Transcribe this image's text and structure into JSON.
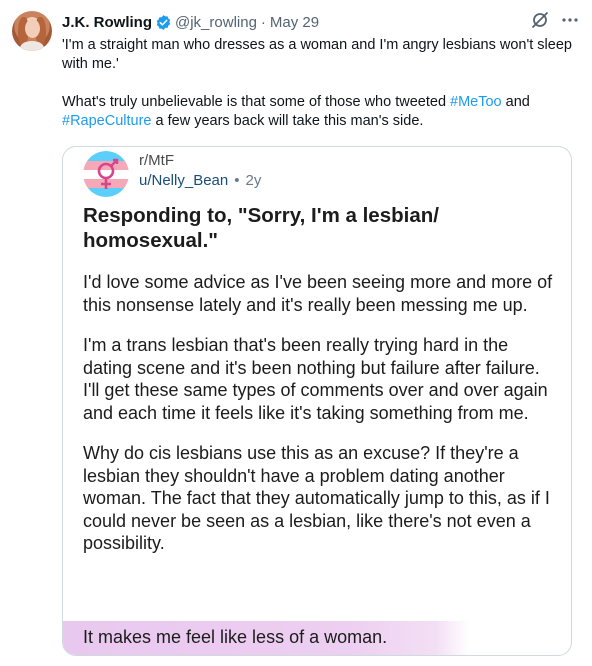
{
  "tweet": {
    "author": {
      "name": "J.K. Rowling",
      "handle": "@jk_rowling",
      "date": "May 29",
      "separator": "·"
    },
    "text": {
      "line1": "'I'm a straight man who dresses as a woman and I'm angry lesbians won't sleep with me.'",
      "line2_before": "What's truly unbelievable is that some of those who tweeted ",
      "hashtag1": "#MeToo",
      "line2_mid": " and ",
      "hashtag2": "#RapeCulture",
      "line2_after": " a few years back will take this man's side."
    },
    "icons": {
      "verified": "verified-badge-icon",
      "grok": "grok-icon",
      "more": "more-icon",
      "subreddit": "trans-flag-icon"
    },
    "colors": {
      "hashtag": "#1d9bf0",
      "verified": "#1d9bf0",
      "highlight": "#e9c8ef",
      "reddit_user": "#1a4d7a"
    }
  },
  "card": {
    "subreddit": "r/MtF",
    "user": "u/Nelly_Bean",
    "separator": "•",
    "age": "2y",
    "title": "Responding to, \"Sorry, I'm a lesbian/ homosexual.\"",
    "paragraphs": [
      "I'd love some advice as I've been seeing more and more of this nonsense lately and it's really been messing me up.",
      "I'm a trans lesbian that's been really trying hard in the dating scene and it's been nothing but failure after failure. I'll get these same types of comments over and over again and each time it feels like it's taking something from me.",
      "Why do cis lesbians use this as an excuse? If they're a lesbian they shouldn't have a problem dating another woman. The fact that they automatically jump to this, as if I could never be seen as a lesbian, like there's not even a possibility."
    ],
    "highlighted": "It makes me feel like less of a woman."
  }
}
